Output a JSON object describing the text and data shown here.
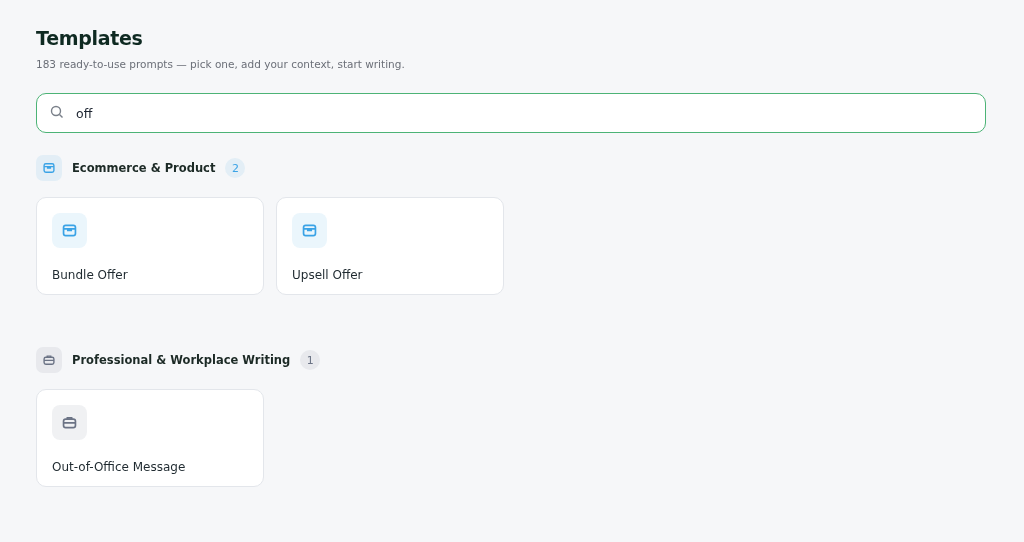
{
  "header": {
    "title": "Templates",
    "subtitle": "183 ready-to-use prompts — pick one, add your context, start writing."
  },
  "search": {
    "value": "off"
  },
  "categories": [
    {
      "name": "Ecommerce & Product",
      "count": "2",
      "kind": "box",
      "color": "#3ba3e6",
      "templates": [
        {
          "name": "Bundle Offer"
        },
        {
          "name": "Upsell Offer"
        }
      ]
    },
    {
      "name": "Professional & Workplace Writing",
      "count": "1",
      "kind": "briefcase",
      "color": "#6b7385",
      "templates": [
        {
          "name": "Out-of-Office Message"
        }
      ]
    }
  ]
}
